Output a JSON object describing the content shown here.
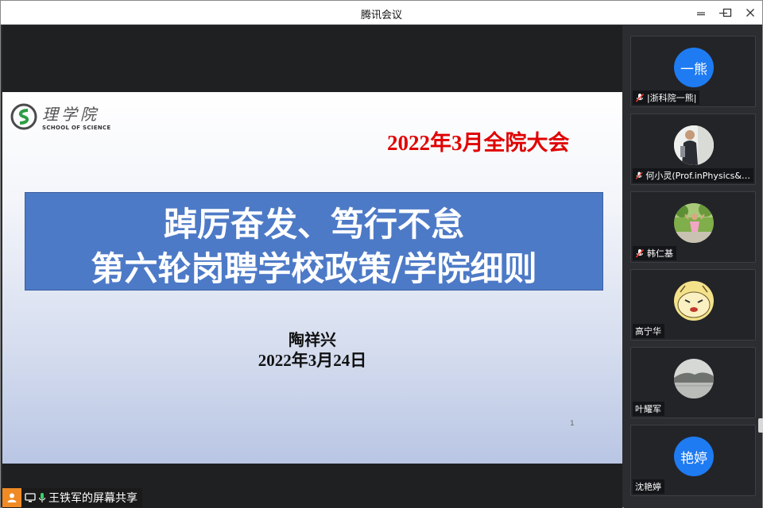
{
  "window": {
    "title": "腾讯会议"
  },
  "slide": {
    "logo_cn": "理学院",
    "logo_en": "SCHOOL OF SCIENCE",
    "conference_title": "2022年3月全院大会",
    "banner_line1": "踔厉奋发、笃行不怠",
    "banner_line2": "第六轮岗聘学校政策/学院细则",
    "speaker": "陶祥兴",
    "date": "2022年3月24日",
    "page_number": "1"
  },
  "share_bar": {
    "label": "王铁军的屏幕共享"
  },
  "participants": [
    {
      "name": "|浙科院一熊|",
      "avatar_text": "一熊",
      "avatar_kind": "blue-initials",
      "mic": "muted"
    },
    {
      "name": "何小灵(Prof.inPhysics&…",
      "avatar_text": "",
      "avatar_kind": "photo-person",
      "mic": "muted"
    },
    {
      "name": "韩仁基",
      "avatar_text": "",
      "avatar_kind": "photo-child-outdoor",
      "mic": "muted"
    },
    {
      "name": "高宁华",
      "avatar_text": "",
      "avatar_kind": "cartoon-face",
      "mic": "none"
    },
    {
      "name": "叶耀军",
      "avatar_text": "",
      "avatar_kind": "photo-landscape",
      "mic": "none"
    },
    {
      "name": "沈艳婷",
      "avatar_text": "艳婷",
      "avatar_kind": "blue-initials",
      "mic": "none"
    }
  ],
  "colors": {
    "accent_blue": "#1e7bf2",
    "banner_blue": "#4d7ac7",
    "title_red": "#e00000",
    "share_orange": "#f08a24"
  }
}
